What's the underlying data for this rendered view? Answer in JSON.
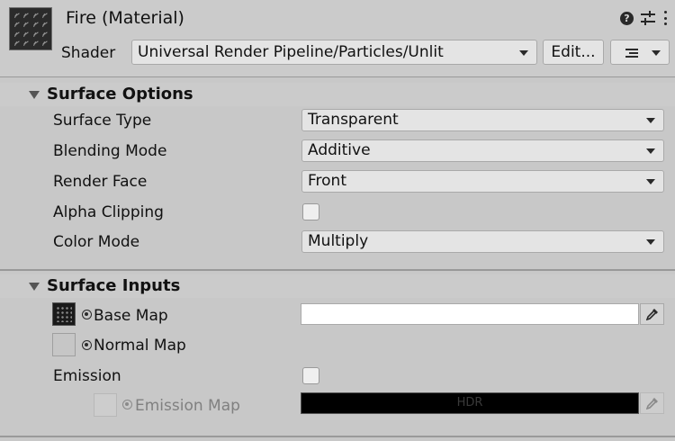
{
  "header": {
    "title": "Fire (Material)",
    "shader_label": "Shader",
    "shader_value": "Universal Render Pipeline/Particles/Unlit",
    "edit_label": "Edit...",
    "icons": [
      "help-icon",
      "preset-icon",
      "kebab-menu-icon",
      "list-icon",
      "chevron-down-icon"
    ]
  },
  "surface_options": {
    "title": "Surface Options",
    "surface_type": {
      "label": "Surface Type",
      "value": "Transparent"
    },
    "blending_mode": {
      "label": "Blending Mode",
      "value": "Additive"
    },
    "render_face": {
      "label": "Render Face",
      "value": "Front"
    },
    "alpha_clipping": {
      "label": "Alpha Clipping",
      "checked": false
    },
    "color_mode": {
      "label": "Color Mode",
      "value": "Multiply"
    }
  },
  "surface_inputs": {
    "title": "Surface Inputs",
    "base_map": {
      "label": "Base Map",
      "color": "#ffffff"
    },
    "normal_map": {
      "label": "Normal Map"
    },
    "emission": {
      "label": "Emission",
      "checked": false
    },
    "emission_map": {
      "label": "Emission Map",
      "color": "#000000",
      "badge": "HDR"
    }
  }
}
